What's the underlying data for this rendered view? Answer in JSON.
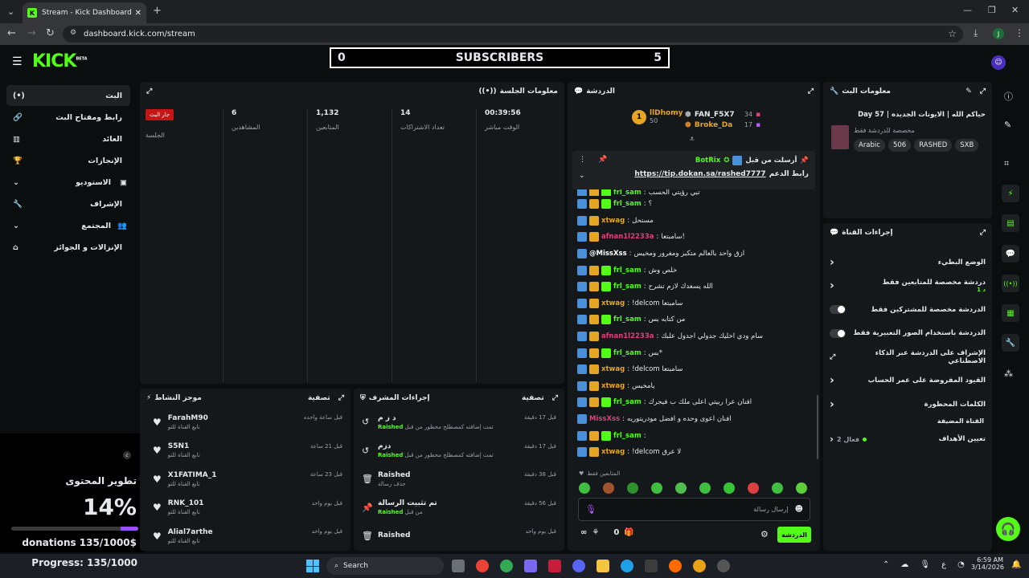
{
  "browser": {
    "tab_title": "Stream - Kick Dashboard",
    "url": "dashboard.kick.com/stream",
    "profile_letter": "J"
  },
  "header": {
    "logo": "KICK",
    "logo_badge": "BETA",
    "subs_left": "0",
    "subs_title": "SUBSCRIBERS",
    "subs_right": "5"
  },
  "sidebar": {
    "items": [
      {
        "label": "البث"
      },
      {
        "label": "رابط ومفتاح البث"
      },
      {
        "label": "العائد"
      },
      {
        "label": "الإنجازات"
      },
      {
        "label": "الاستوديو"
      },
      {
        "label": "الإشراف"
      },
      {
        "label": "المجتمع"
      },
      {
        "label": "الإنزالات و الجوائز"
      }
    ]
  },
  "session": {
    "title": "معلومات الجلسة",
    "live_badge": "جار البث",
    "session_label": "الجلسة",
    "stats": [
      {
        "value": "6",
        "label": "المشاهدين"
      },
      {
        "value": "1,132",
        "label": "المتابعين"
      },
      {
        "value": "14",
        "label": "تعداد الاشتراكات"
      },
      {
        "value": "00:39:56",
        "label": "الوقت مباشر"
      }
    ]
  },
  "activity": {
    "title": "موجز النشاط",
    "filter": "تصفية",
    "items": [
      {
        "name": "FarahM90",
        "sub": "تابع القناة للتو",
        "time": "قبل ساعة واحده"
      },
      {
        "name": "S5N1",
        "sub": "تابع القناة للتو",
        "time": "قبل 21 ساعة"
      },
      {
        "name": "X1FATIMA_1",
        "sub": "تابع القناة للتو",
        "time": "قبل 23 ساعة"
      },
      {
        "name": "RNK_101",
        "sub": "تابع القناة للتو",
        "time": "قبل يوم واحد"
      },
      {
        "name": "Alial7arthe",
        "sub": "تابع القناة للتو",
        "time": "قبل يوم واحد"
      }
    ]
  },
  "overlay": {
    "title": "تطوير المحتوى",
    "percent": "14%",
    "progress_fraction": 0.14,
    "donations": "donations 135/1000$",
    "progress": "Progress: 135/1000"
  },
  "modlog": {
    "title": "إجراءات المشرف",
    "filter": "تصفية",
    "items": [
      {
        "title": "د ز م",
        "mod": "Raished",
        "sub": "تمت إضافته كمصطلح محظور من قبل",
        "time": "قبل 17 دقيقة"
      },
      {
        "title": "دزم",
        "mod": "Raished",
        "sub": "تمت إضافته كمصطلح محظور من قبل",
        "time": "قبل 17 دقيقة"
      },
      {
        "title": "Raished",
        "mod": "",
        "sub": "حذف رسالة",
        "time": "قبل 38 دقيقة"
      },
      {
        "title": "تم تثبيت الرسالة",
        "mod": "Raished",
        "sub": "من قبل",
        "time": "قبل 56 دقيقة"
      },
      {
        "title": "Raished",
        "mod": "",
        "sub": "",
        "time": "قبل يوم واحد"
      }
    ]
  },
  "chat": {
    "title": "الدردشة",
    "top_gifters": [
      {
        "name": "llDhomy",
        "value": "50",
        "rank": "1"
      },
      {
        "name": "FAN_F5X7",
        "value": "34"
      },
      {
        "name": "Broke_Da",
        "value": "17"
      }
    ],
    "pinned": {
      "header": "أرسلت من قبل",
      "user": "BotRix",
      "label": "رابط الدعم",
      "link": "https://tip.dokan.sa/rashed7777"
    },
    "messages": [
      {
        "user": "frl_sam",
        "text": "تبي رؤيتي الحسب",
        "color": "#53fc18"
      },
      {
        "user": "frl_sam",
        "text": "؟",
        "color": "#53fc18"
      },
      {
        "user": "xtwag",
        "text": "مستحل",
        "color": "#e5a623"
      },
      {
        "user": "afnan1l2233a",
        "text": "سامبتعا!",
        "color": "#e23f7a"
      },
      {
        "user": "@MissXss",
        "text": "ازق واحد بالعالم متكبر ومغرور ومخيس",
        "color": "#ffffff"
      },
      {
        "user": "frl_sam",
        "text": "خلص وش",
        "color": "#53fc18"
      },
      {
        "user": "frl_sam",
        "text": "الله يسعدك لازم تشرح",
        "color": "#53fc18"
      },
      {
        "user": "xtwag",
        "text": "!delcom سامبتعا",
        "color": "#e5a623"
      },
      {
        "user": "frl_sam",
        "text": "من كتابه بس",
        "color": "#53fc18"
      },
      {
        "user": "afnan1l2233a",
        "text": "سام ودي اخليك جدولي اجدول علبك",
        "color": "#e23f7a"
      },
      {
        "user": "frl_sam",
        "text": "بس*",
        "color": "#53fc18"
      },
      {
        "user": "xtwag",
        "text": "!delcom سامبتعا",
        "color": "#e5a623"
      },
      {
        "user": "xtwag",
        "text": "يامخيس",
        "color": "#e5a623"
      },
      {
        "user": "frl_sam",
        "text": "افنان عرا ربيتي اعلى ملك ب فيجرك",
        "color": "#53fc18"
      },
      {
        "user": "MissXss",
        "text": "افنان اعوى وحده و افضل مودريتوريه",
        "color": "#e23f7a"
      },
      {
        "user": "frl_sam",
        "text": "",
        "color": "#53fc18"
      },
      {
        "user": "xtwag",
        "text": "!delcom لا عرق",
        "color": "#e5a623"
      }
    ],
    "followers_only": "المتابعين فقط",
    "placeholder": "إرسال رسالة",
    "send_label": "الدردشة",
    "points": "0"
  },
  "stream_info": {
    "title": "معلومات البث",
    "stream_title": "حياكم الله | الايونات الجديده | 57 Day",
    "category": "مخصصة للدردشة فقط",
    "tags": [
      "Arabic",
      "506",
      "RASHED",
      "SXB"
    ]
  },
  "channel_actions": {
    "title": "إجراءات القناة",
    "items": [
      {
        "label": "الوضع البطيء",
        "type": "chevron"
      },
      {
        "label": "دردشة مخصصة للمتابعين فقط",
        "sub": "1 د",
        "type": "chevron"
      },
      {
        "label": "الدردشة مخصصة للمشتركين فقط",
        "type": "toggle"
      },
      {
        "label": "الدردشة باستخدام الصور التعبيرية فقط",
        "type": "toggle"
      },
      {
        "label": "الإشراف على الدردشة عبر الذكاء الاصطناعي",
        "type": "link"
      },
      {
        "label": "القيود المفروضة على عمر الحساب",
        "type": "chevron"
      },
      {
        "label": "الكلمات المحظورة",
        "type": "chevron"
      }
    ],
    "featured_label": "القناة المضيفة",
    "goals_label": "تعيين الأهداف",
    "goals_value": "فعال 2"
  },
  "taskbar": {
    "search": "Search",
    "lang": "ع",
    "time": "6:59 AM",
    "date": "3/14/2026"
  }
}
